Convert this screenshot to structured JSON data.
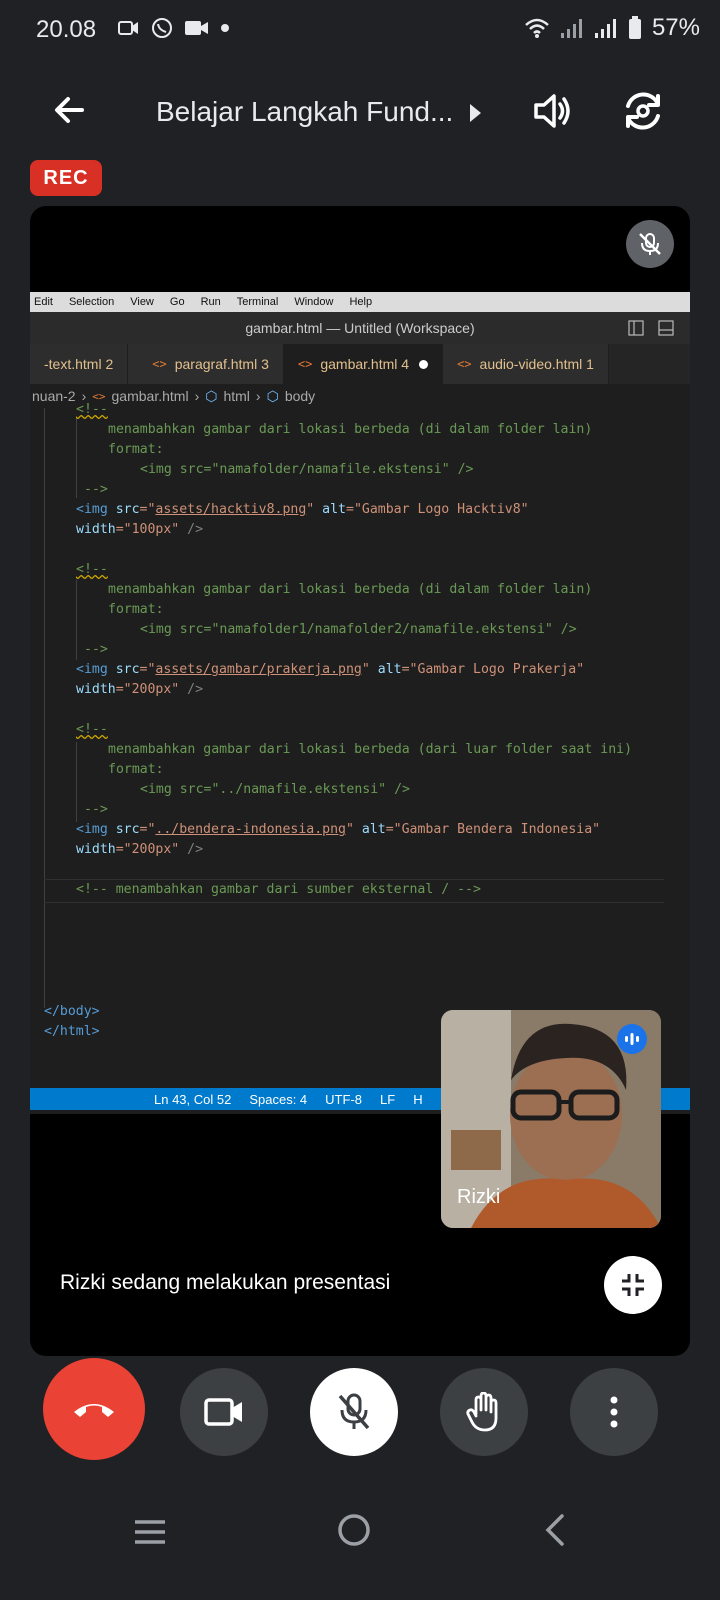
{
  "status_bar": {
    "time": "20.08",
    "battery": "57%"
  },
  "app_bar": {
    "title": "Belajar Langkah Fund..."
  },
  "recording_badge": "REC",
  "vscode": {
    "menu": [
      "Edit",
      "Selection",
      "View",
      "Go",
      "Run",
      "Terminal",
      "Window",
      "Help"
    ],
    "window_title": "gambar.html — Untitled (Workspace)",
    "tabs": [
      {
        "label": "-text.html",
        "count": "2",
        "active": false
      },
      {
        "label": "paragraf.html",
        "count": "3",
        "active": false
      },
      {
        "label": "gambar.html",
        "count": "4",
        "active": true
      },
      {
        "label": "audio-video.html",
        "count": "1",
        "active": false
      }
    ],
    "breadcrumb": [
      "nuan-2",
      "gambar.html",
      "html",
      "body"
    ],
    "code_lines": {
      "l01": "<!--",
      "l02": "menambahkan gambar dari lokasi berbeda (di dalam folder lain)",
      "l03": "format:",
      "l04": "<img src=\"namafolder/namafile.ekstensi\" />",
      "l05": "-->",
      "l06_a": "<img ",
      "l06_b": "src",
      "l06_c": "=\"",
      "l06_d": "assets/hacktiv8.png",
      "l06_e": "\" ",
      "l06_f": "alt",
      "l06_g": "=\"Gambar Logo Hacktiv8\"",
      "l07_a": "width",
      "l07_b": "=\"100px\"",
      "l07_c": " />",
      "l08": "<!--",
      "l09": "menambahkan gambar dari lokasi berbeda (di dalam folder lain)",
      "l10": "format:",
      "l11": "<img src=\"namafolder1/namafolder2/namafile.ekstensi\" />",
      "l12": "-->",
      "l13_a": "<img ",
      "l13_b": "src",
      "l13_c": "=\"",
      "l13_d": "assets/gambar/prakerja.png",
      "l13_e": "\" ",
      "l13_f": "alt",
      "l13_g": "=\"Gambar Logo Prakerja\"",
      "l14_a": "width",
      "l14_b": "=\"200px\"",
      "l14_c": " />",
      "l15": "<!--",
      "l16": "menambahkan gambar dari lokasi berbeda (dari luar folder saat ini)",
      "l17": "format:",
      "l18": "<img src=\"../namafile.ekstensi\" />",
      "l19": "-->",
      "l20_a": "<img ",
      "l20_b": "src",
      "l20_c": "=\"",
      "l20_d": "../bendera-indonesia.png",
      "l20_e": "\" ",
      "l20_f": "alt",
      "l20_g": "=\"Gambar Bendera Indonesia\"",
      "l21_a": "width",
      "l21_b": "=\"200px\"",
      "l21_c": " />",
      "l22": "<!-- menambahkan gambar dari sumber eksternal / -->",
      "l23": "</body>",
      "l24": "</html>"
    },
    "status": {
      "position": "Ln 43, Col 52",
      "spaces": "Spaces: 4",
      "encoding": "UTF-8",
      "eol": "LF",
      "lang": "H"
    }
  },
  "self_view": {
    "name": "Rizki"
  },
  "presenting_text": "Rizki sedang melakukan presentasi",
  "colors": {
    "end_call": "#ea4335",
    "rec": "#d93025",
    "vscode_status": "#007acc"
  }
}
